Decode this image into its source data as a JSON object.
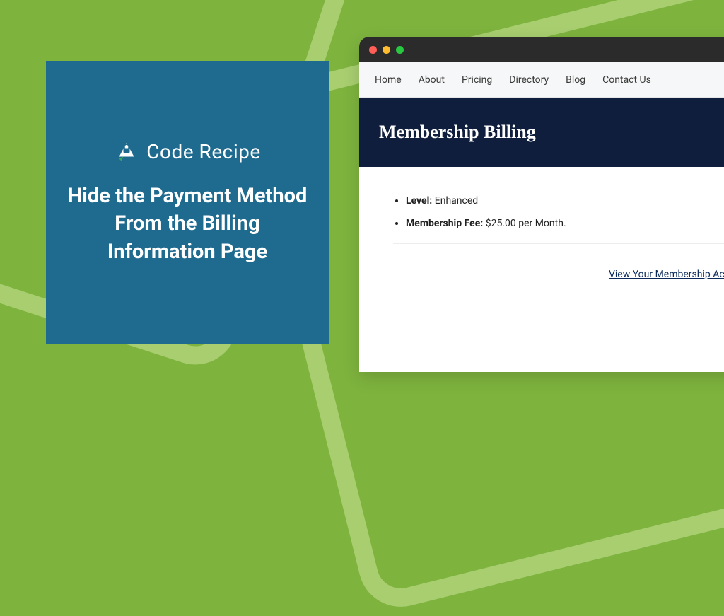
{
  "card": {
    "brand_name": "Code Recipe",
    "headline": "Hide the Payment Method From the Billing Information Page"
  },
  "browser": {
    "nav": [
      "Home",
      "About",
      "Pricing",
      "Directory",
      "Blog",
      "Contact Us"
    ],
    "page_title": "Membership Billing",
    "bullets": {
      "level_label": "Level:",
      "level_value": "Enhanced",
      "fee_label": "Membership Fee:",
      "fee_value": "$25.00 per Month."
    },
    "account_link": "View Your Membership Acco"
  },
  "colors": {
    "bg": "#7eb33e",
    "accent": "#a8ce70",
    "card_bg": "#1f6b8f",
    "hero_bg": "#0f1e3c",
    "link": "#0b2a5b"
  }
}
